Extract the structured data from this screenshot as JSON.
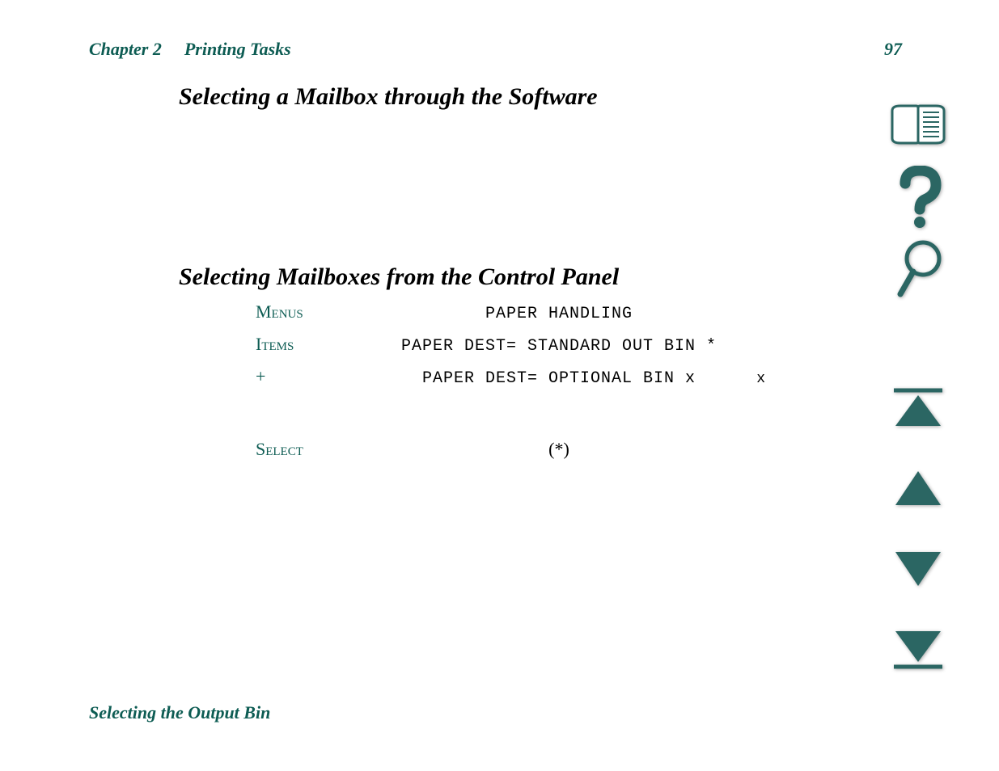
{
  "header": {
    "chapter": "Chapter 2",
    "section": "Printing Tasks",
    "page": "97"
  },
  "title1": "Selecting a Mailbox through the Software",
  "title2": "Selecting Mailboxes from the Control Panel",
  "rows": {
    "r0": {
      "label": "Menus",
      "value": "PAPER HANDLING",
      "suffix": ""
    },
    "r1": {
      "label": "Items",
      "value": "PAPER DEST= STANDARD OUT BIN *",
      "suffix": ""
    },
    "r2": {
      "label": "+",
      "value": "PAPER DEST= OPTIONAL BIN x",
      "suffix": "x"
    },
    "r3": {
      "label": "Select",
      "value": "(*)",
      "suffix": ""
    }
  },
  "footer": "Selecting the Output Bin",
  "nav": {
    "toc": "book-icon",
    "help": "help-icon",
    "search": "search-icon",
    "first": "go-first-icon",
    "prev": "go-prev-icon",
    "next": "go-next-icon",
    "last": "go-last-icon"
  },
  "colors": {
    "accent": "#0d5c53",
    "navFill": "#2b6663"
  }
}
